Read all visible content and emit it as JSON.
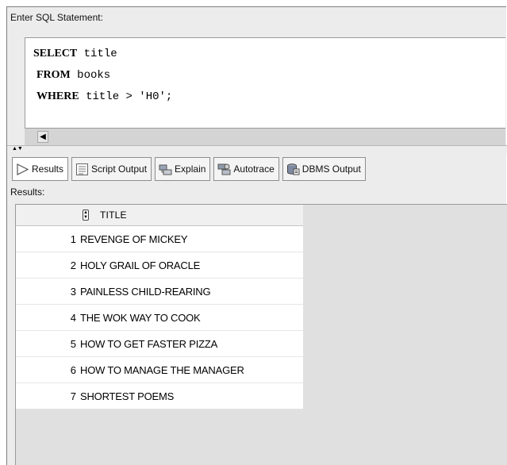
{
  "sql": {
    "label": "Enter SQL Statement:",
    "lines": [
      {
        "keyword": "SELECT",
        "rest": " title"
      },
      {
        "keyword": "FROM",
        "rest": " books"
      },
      {
        "keyword": "WHERE",
        "rest": " title > 'H0';"
      }
    ]
  },
  "tabs": [
    {
      "label": "Results",
      "icon": "play-arrow-icon",
      "active": true
    },
    {
      "label": "Script Output",
      "icon": "script-output-icon"
    },
    {
      "label": "Explain",
      "icon": "explain-plan-icon"
    },
    {
      "label": "Autotrace",
      "icon": "autotrace-icon"
    },
    {
      "label": "DBMS Output",
      "icon": "dbms-output-icon"
    }
  ],
  "results": {
    "label": "Results:",
    "column": "TITLE",
    "rows": [
      {
        "n": "1",
        "title": "REVENGE OF MICKEY"
      },
      {
        "n": "2",
        "title": "HOLY GRAIL OF ORACLE"
      },
      {
        "n": "3",
        "title": "PAINLESS CHILD-REARING"
      },
      {
        "n": "4",
        "title": "THE WOK WAY TO COOK"
      },
      {
        "n": "5",
        "title": "HOW TO GET FASTER PIZZA"
      },
      {
        "n": "6",
        "title": "HOW TO MANAGE THE MANAGER"
      },
      {
        "n": "7",
        "title": "SHORTEST POEMS"
      }
    ]
  },
  "colors": {
    "panel": "#ececec",
    "grid_background": "#e0e0e0",
    "active_tab": "#ffffff"
  }
}
